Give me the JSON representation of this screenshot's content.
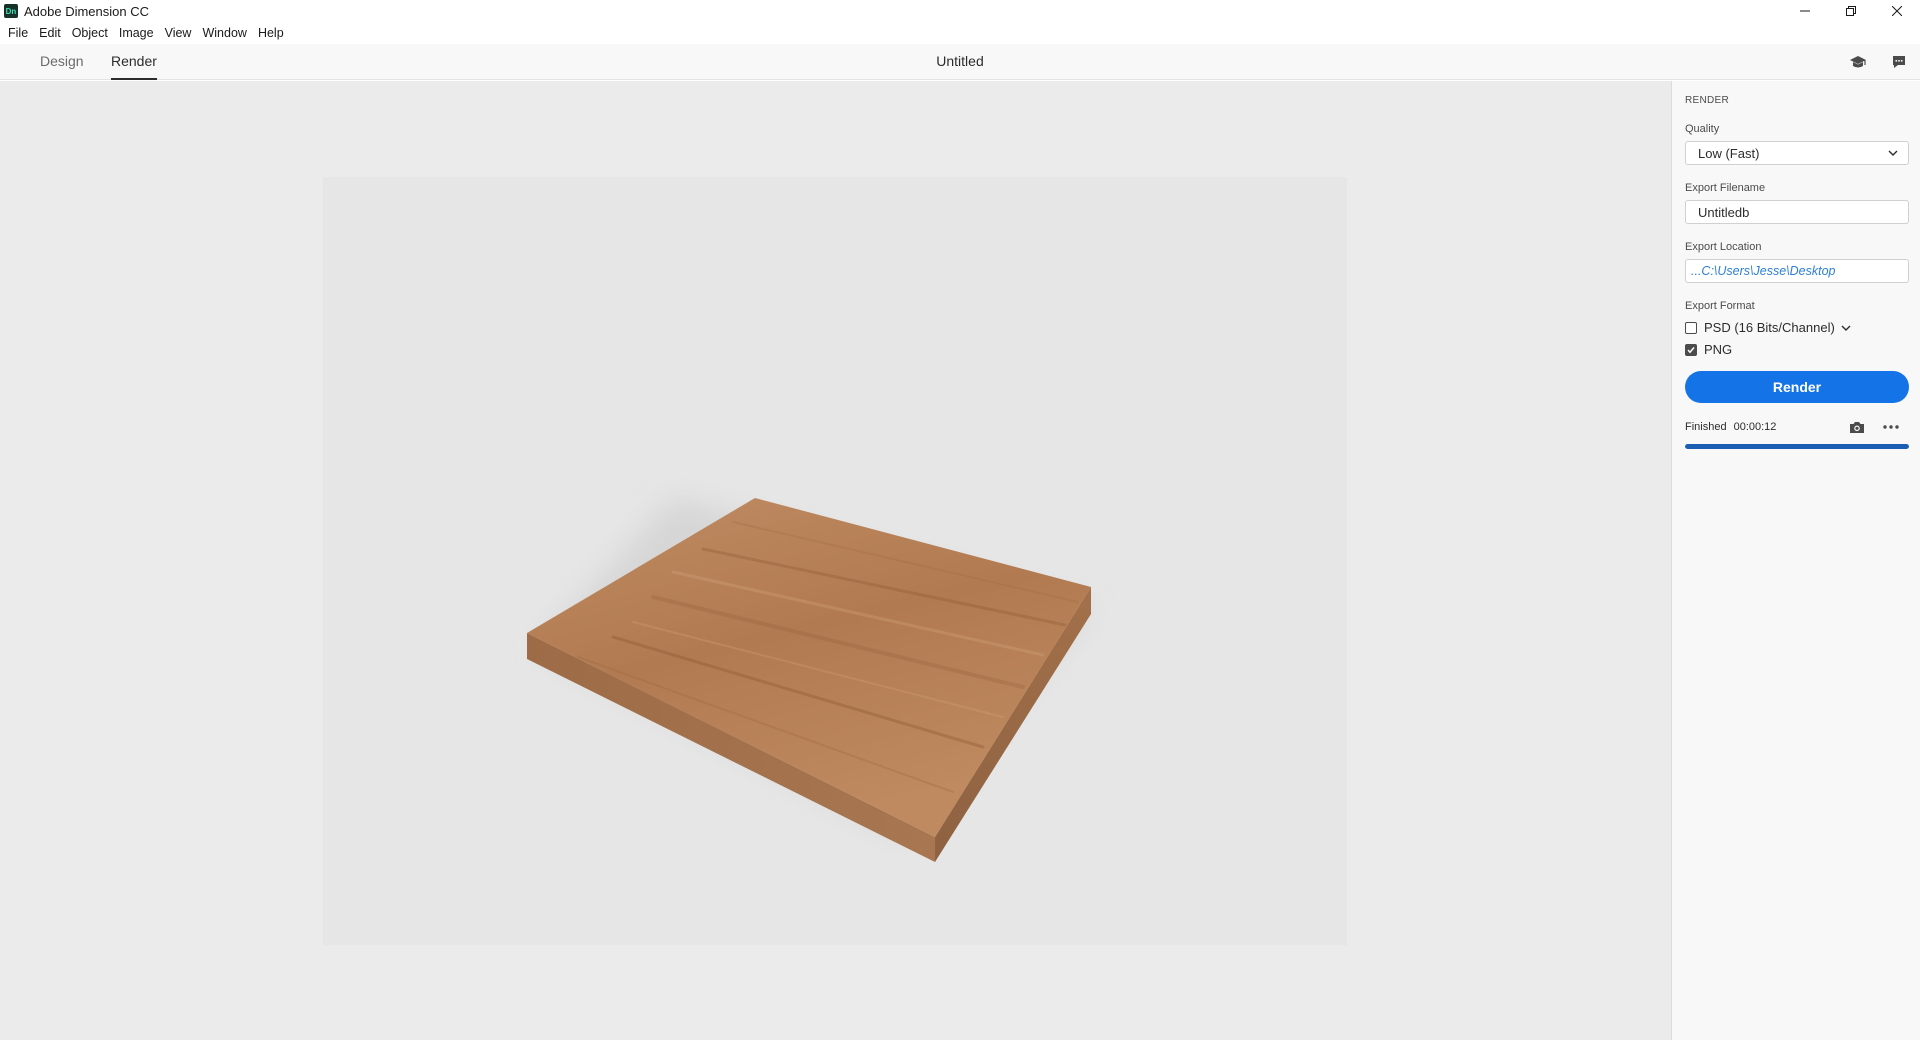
{
  "window": {
    "app_logo": "Dn",
    "title": "Adobe Dimension CC",
    "controls": [
      "minimize-icon",
      "restore-icon",
      "close-icon"
    ]
  },
  "menu": [
    "File",
    "Edit",
    "Object",
    "Image",
    "View",
    "Window",
    "Help"
  ],
  "modes": {
    "tabs": [
      "Design",
      "Render"
    ],
    "active": "Render",
    "document_title": "Untitled",
    "icons": [
      "learn-icon",
      "feedback-icon"
    ]
  },
  "canvas": {
    "object": "wood-board",
    "colors": {
      "background": "#e6e6e6",
      "wood": "#b57f55"
    }
  },
  "render_panel": {
    "heading": "RENDER",
    "quality_label": "Quality",
    "quality_value": "Low (Fast)",
    "filename_label": "Export Filename",
    "filename_value": "Untitledb",
    "location_label": "Export Location",
    "location_value": "...C:\\Users\\Jesse\\Desktop",
    "format_label": "Export Format",
    "formats": [
      {
        "label": "PSD (16 Bits/Channel)",
        "checked": false,
        "has_dropdown": true
      },
      {
        "label": "PNG",
        "checked": true,
        "has_dropdown": false
      }
    ],
    "render_button": "Render",
    "status_label": "Finished",
    "status_time": "00:00:12",
    "status_icons": [
      "camera-icon",
      "more-icon"
    ],
    "progress_percent": 100,
    "accent": "#1473e6"
  }
}
